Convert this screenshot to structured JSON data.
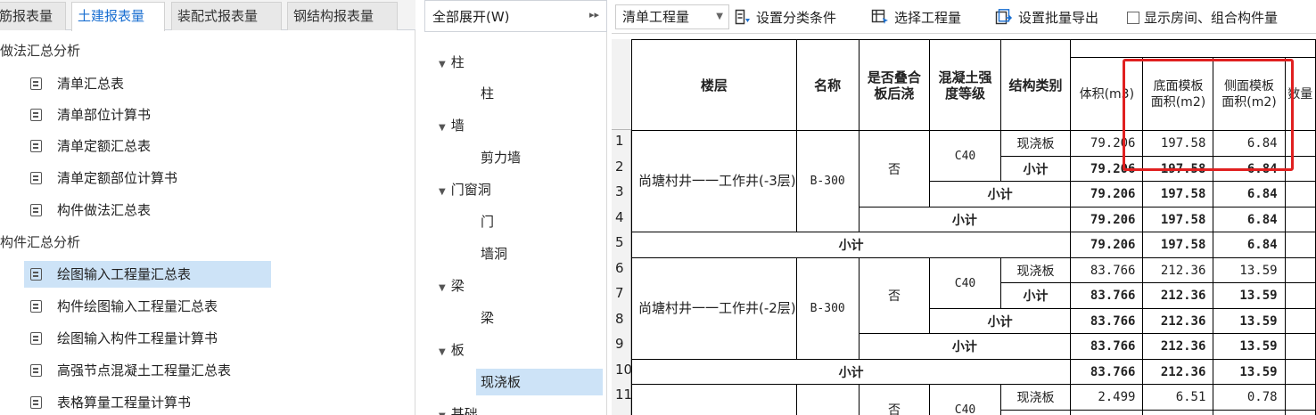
{
  "colors": {
    "accent": "#1a6fd1",
    "selected_bg": "#cde3f7",
    "highlight_border": "#e02020"
  },
  "left": {
    "tabs": [
      {
        "label": "筋报表量",
        "active": false
      },
      {
        "label": "土建报表量",
        "active": true
      },
      {
        "label": "装配式报表量",
        "active": false
      },
      {
        "label": "钢结构报表量",
        "active": false
      }
    ],
    "groups": [
      {
        "label": "做法汇总分析"
      },
      {
        "label": "构件汇总分析"
      }
    ],
    "items": [
      {
        "label": "清单汇总表",
        "icon": "document-icon"
      },
      {
        "label": "清单部位计算书",
        "icon": "document-icon"
      },
      {
        "label": "清单定额汇总表",
        "icon": "document-icon"
      },
      {
        "label": "清单定额部位计算书",
        "icon": "document-icon"
      },
      {
        "label": "构件做法汇总表",
        "icon": "document-icon"
      },
      {
        "label": "绘图输入工程量汇总表",
        "icon": "document-icon",
        "selected": true
      },
      {
        "label": "构件绘图输入工程量汇总表",
        "icon": "document-icon"
      },
      {
        "label": "绘图输入构件工程量计算书",
        "icon": "document-icon"
      },
      {
        "label": "高强节点混凝土工程量汇总表",
        "icon": "document-icon"
      },
      {
        "label": "表格算量工程量计算书",
        "icon": "document-icon"
      }
    ]
  },
  "mid": {
    "expand_label": "全部展开(W)",
    "expand_arrow": "▸▸",
    "tree": [
      {
        "label": "柱",
        "level": 0
      },
      {
        "label": "柱",
        "level": 1
      },
      {
        "label": "墙",
        "level": 0
      },
      {
        "label": "剪力墙",
        "level": 1
      },
      {
        "label": "门窗洞",
        "level": 0
      },
      {
        "label": "门",
        "level": 1
      },
      {
        "label": "墙洞",
        "level": 1
      },
      {
        "label": "梁",
        "level": 0
      },
      {
        "label": "梁",
        "level": 1
      },
      {
        "label": "板",
        "level": 0
      },
      {
        "label": "现浇板",
        "level": 1,
        "selected": true
      },
      {
        "label": "基础",
        "level": 0
      }
    ]
  },
  "toolbar": {
    "qty_select": "清单工程量",
    "set_category": "设置分类条件",
    "select_quantity": "选择工程量",
    "set_batch_export": "设置批量导出",
    "show_rooms": "显示房间、组合构件量"
  },
  "table": {
    "headers": {
      "floor": "楼层",
      "name": "名称",
      "overlap_l1": "是否叠合",
      "overlap_l2": "板后浇",
      "grade_l1": "混凝土强",
      "grade_l2": "度等级",
      "struct": "结构类别",
      "volume": "体积(m3)",
      "bottom_l1": "底面模板",
      "bottom_l2": "面积(m2)",
      "side_l1": "侧面模板",
      "side_l2": "面积(m2)",
      "count": "数量"
    },
    "row_numbers": [
      "1",
      "2",
      "3",
      "4",
      "5",
      "6",
      "7",
      "8",
      "9",
      "10",
      "11"
    ],
    "groups": [
      {
        "floor": "尚塘村井一一工作井(-3层)",
        "name": "B-300",
        "overlap": "否",
        "grade": "C40",
        "struct": "现浇板",
        "subtotal": "小计",
        "rows": [
          [
            "79.206",
            "197.58",
            "6.84"
          ],
          [
            "79.206",
            "197.58",
            "6.84"
          ],
          [
            "79.206",
            "197.58",
            "6.84"
          ],
          [
            "79.206",
            "197.58",
            "6.84"
          ],
          [
            "79.206",
            "197.58",
            "6.84"
          ]
        ]
      },
      {
        "floor": "尚塘村井一一工作井(-2层)",
        "name": "B-300",
        "overlap": "否",
        "grade": "C40",
        "struct": "现浇板",
        "subtotal": "小计",
        "rows": [
          [
            "83.766",
            "212.36",
            "13.59"
          ],
          [
            "83.766",
            "212.36",
            "13.59"
          ],
          [
            "83.766",
            "212.36",
            "13.59"
          ],
          [
            "83.766",
            "212.36",
            "13.59"
          ],
          [
            "83.766",
            "212.36",
            "13.59"
          ]
        ]
      },
      {
        "overlap": "否",
        "grade": "C40",
        "struct": "现浇板",
        "rows": [
          [
            "2.499",
            "6.51",
            "0.78"
          ]
        ]
      }
    ]
  }
}
